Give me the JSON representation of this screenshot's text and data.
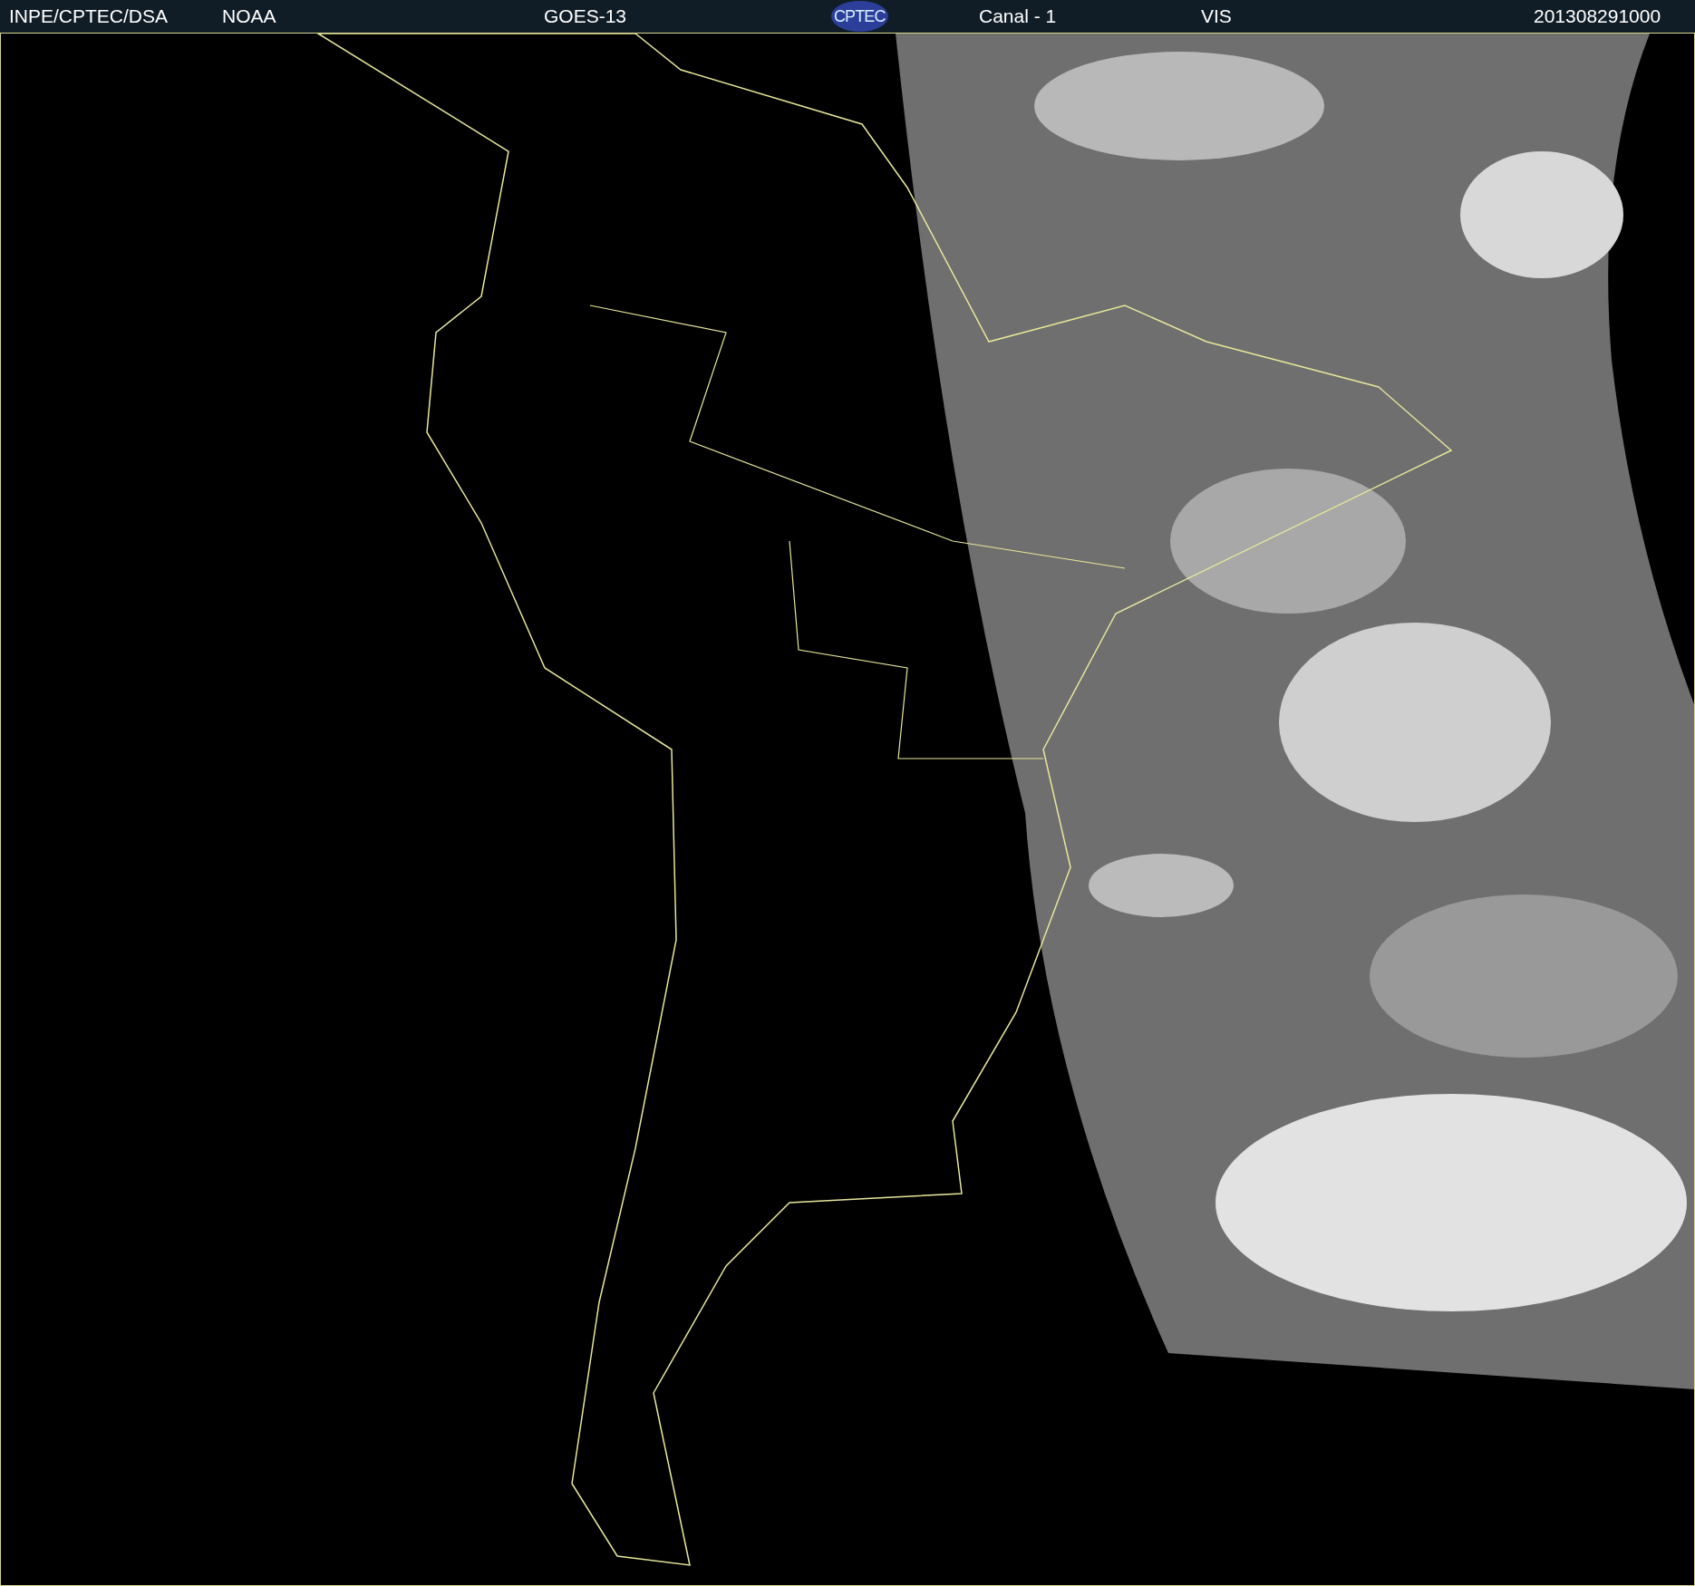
{
  "header": {
    "items": [
      {
        "kind": "text",
        "text": "INPE/CPTEC/DSA"
      },
      {
        "kind": "text",
        "text": "NOAA"
      },
      {
        "kind": "text",
        "text": "GOES-13"
      },
      {
        "kind": "logo",
        "text": "CPTEC"
      },
      {
        "kind": "text",
        "text": "Canal - 1"
      },
      {
        "kind": "text",
        "text": "VIS"
      },
      {
        "kind": "text",
        "text": "201308291000"
      }
    ]
  }
}
